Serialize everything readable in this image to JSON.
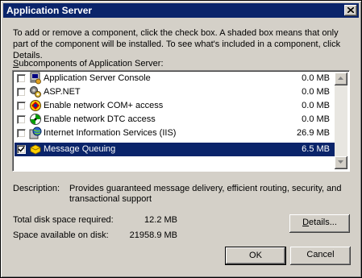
{
  "window": {
    "title": "Application Server"
  },
  "intro_text": "To add or remove a component, click the check box. A shaded box means that only part of the component will be installed. To see what's included in a component, click Details.",
  "list": {
    "label_prefix": "S",
    "label_rest": "ubcomponents of Application Server:",
    "items": [
      {
        "name": "Application Server Console",
        "size": "0.0 MB",
        "checked": false,
        "icon": "console-icon",
        "selected": false
      },
      {
        "name": "ASP.NET",
        "size": "0.0 MB",
        "checked": false,
        "icon": "asp-net-icon",
        "selected": false
      },
      {
        "name": "Enable network COM+ access",
        "size": "0.0 MB",
        "checked": false,
        "icon": "com-plus-icon",
        "selected": false
      },
      {
        "name": "Enable network DTC access",
        "size": "0.0 MB",
        "checked": false,
        "icon": "dtc-icon",
        "selected": false
      },
      {
        "name": "Internet Information Services (IIS)",
        "size": "26.9 MB",
        "checked": false,
        "icon": "iis-icon",
        "selected": false
      },
      {
        "name": "Message Queuing",
        "size": "6.5 MB",
        "checked": true,
        "icon": "message-queuing-icon",
        "selected": true
      }
    ]
  },
  "description": {
    "label": "Description:",
    "text": "Provides guaranteed message delivery, efficient routing, security, and transactional support"
  },
  "disk": {
    "required_label": "Total disk space required:",
    "required_value": "12.2 MB",
    "available_label": "Space available on disk:",
    "available_value": "21958.9 MB"
  },
  "buttons": {
    "details_prefix": "",
    "details_u": "D",
    "details_rest": "etails...",
    "ok": "OK",
    "cancel": "Cancel"
  },
  "colors": {
    "title_bar": "#0a246a",
    "face": "#d4d0c8",
    "selection": "#0a246a"
  }
}
